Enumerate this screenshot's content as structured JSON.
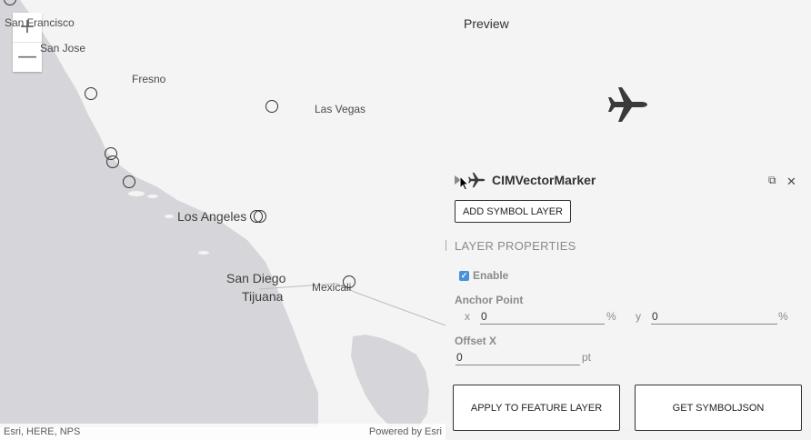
{
  "map": {
    "zoom_in": "+",
    "zoom_out": "—",
    "cities": {
      "san_francisco": "San Francisco",
      "san_jose": "San Jose",
      "fresno": "Fresno",
      "las_vegas": "Las Vegas",
      "los_angeles": "Los Angeles",
      "san_diego": "San Diego",
      "tijuana": "Tijuana",
      "mexicali": "Mexicali"
    },
    "attribution": "Esri, HERE, NPS",
    "powered_by": "Powered by Esri"
  },
  "preview": {
    "title": "Preview",
    "icon": "airplane-icon"
  },
  "symbol": {
    "title": "CIMVectorMarker",
    "icon": "airplane-icon",
    "add_layer": "ADD SYMBOL LAYER",
    "section": "LAYER PROPERTIES",
    "enable_label": "Enable",
    "enable_checked": true,
    "anchor_label": "Anchor Point",
    "x_label": "x",
    "x_value": "0",
    "x_unit": "%",
    "y_label": "y",
    "y_value": "0",
    "y_unit": "%",
    "offset_label": "Offset X",
    "offset_value": "0",
    "offset_unit": "pt"
  },
  "footer": {
    "apply": "APPLY TO FEATURE LAYER",
    "get_json": "GET SYMBOLJSON"
  },
  "colors": {
    "land": "#d5d5d8",
    "water": "#f3f3f3",
    "accent": "#4a90d9"
  }
}
